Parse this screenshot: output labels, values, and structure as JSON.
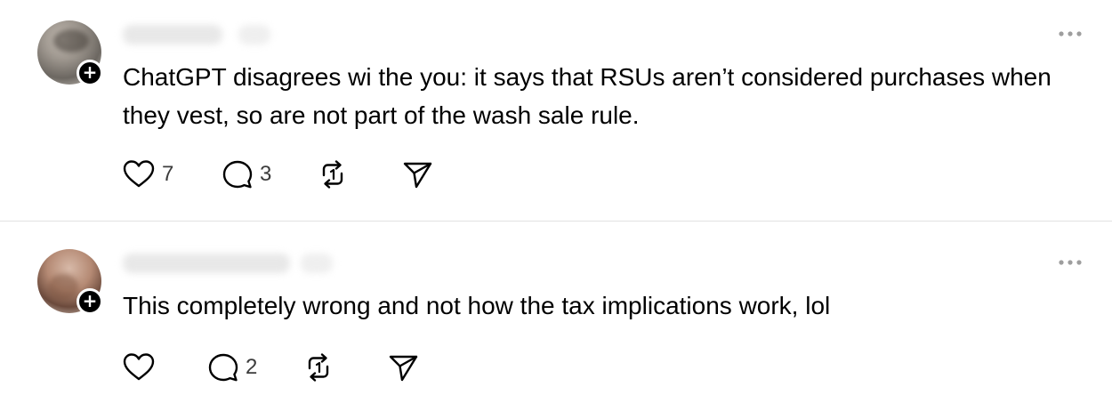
{
  "posts": [
    {
      "text": "ChatGPT disagrees wi the you: it says that RSUs aren’t considered purchases when they vest, so are not part of the wash sale rule.",
      "likes": "7",
      "replies": "3"
    },
    {
      "text": "This completely wrong and not how the tax implications work, lol",
      "likes": "",
      "replies": "2"
    }
  ],
  "icons": {
    "like": "heart-icon",
    "reply": "comment-icon",
    "repost": "repost-icon",
    "share": "send-icon",
    "more": "more-icon",
    "follow": "plus-icon"
  },
  "colors": {
    "text": "#000000",
    "count": "#3c3c3c",
    "divider": "#e2e2e2",
    "icon_muted": "#9e9e9e"
  }
}
